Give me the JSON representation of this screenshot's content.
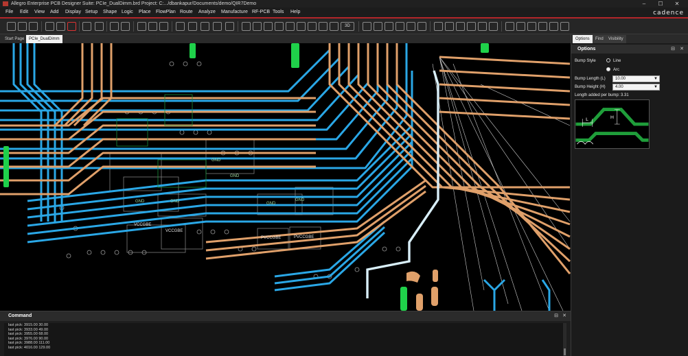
{
  "window": {
    "title": "Allegro Enterprise PCB Designer Suite: PCIe_DualDimm.brd  Project: C:.../dbankapur/Documents/demo/QIR7Demo",
    "controls": [
      "–",
      "☐",
      "✕"
    ]
  },
  "menu": {
    "items": [
      "File",
      "Edit",
      "View",
      "Add",
      "Display",
      "Setup",
      "Shape",
      "Logic",
      "Place",
      "FlowPlan",
      "Route",
      "Analyze",
      "Manufacture",
      "RF-PCB",
      "Tools",
      "Help"
    ],
    "brand": "cadence"
  },
  "toolbar": {
    "zoom_combo_label": "3D"
  },
  "canvas": {
    "tabs": [
      "Start Page",
      "PCIe_DualDimm"
    ],
    "active_tab": "PCIe_DualDimm",
    "component_labels": [
      "GND",
      "GND",
      "GND",
      "GND",
      "GND",
      "GND",
      "VCCGBE",
      "VCCGBE",
      "PVCCGBE",
      "PVCCGBE"
    ],
    "colors": {
      "background": "#000000",
      "trace_blue": "#2aa7e6",
      "trace_orange": "#e0a06a",
      "pad_green": "#1fd14a",
      "outline_gray": "#8a8a8a",
      "highlight": "#d8eef8"
    }
  },
  "options_panel": {
    "tabs": [
      "Options",
      "Find",
      "Visibility"
    ],
    "active_tab": "Options",
    "header": "Options",
    "header_controls": [
      "⊟",
      "✕"
    ],
    "bump_style_label": "Bump Style",
    "bump_style_options": [
      "Line",
      "Arc"
    ],
    "bump_style_selected": "Arc",
    "bump_length_label": "Bump Length (L)",
    "bump_length_value": "10.00",
    "bump_height_label": "Bump Height (H)",
    "bump_height_value": "4.00",
    "length_added_text": "Length added per bump: 3.31",
    "diagram_labels": {
      "length": "L",
      "height": "H"
    }
  },
  "command_window": {
    "title": "Command",
    "header_controls": [
      "⊟",
      "✕"
    ],
    "log": [
      "last pick:  3915.00 30.00",
      "last pick:  3933.00 49.00",
      "last pick:  3955.00 68.00",
      "last pick:  3976.00 90.00",
      "last pick:  3988.00 111.00",
      "last pick:  4016.00 129.00"
    ]
  }
}
